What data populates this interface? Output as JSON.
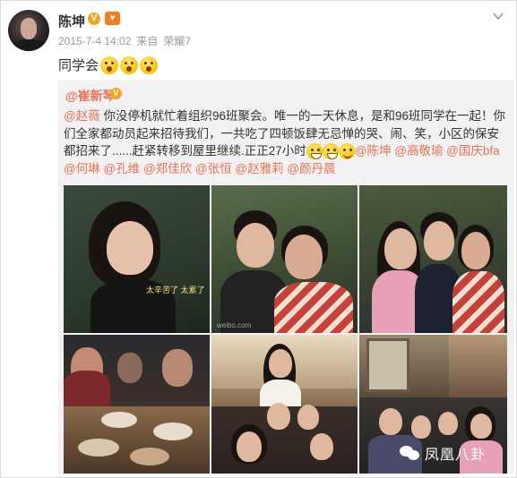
{
  "post": {
    "author": "陈坤",
    "verified_badge": "V",
    "member_badge": "♥",
    "time": "2015-7-4 14:02",
    "source_prefix": "来自",
    "source": "荣耀7",
    "text": "同学会",
    "emojis": [
      "surprised-emoji",
      "surprised-emoji",
      "surprised-emoji"
    ]
  },
  "repost": {
    "author": "@崔新琴",
    "verified_badge": "V",
    "text_parts": [
      {
        "type": "mention",
        "text": "@赵薇"
      },
      {
        "type": "text",
        "text": " 你没停机就忙着组织96班聚会。唯一的一天休息，是和96班同学在一起！你们全家都动员起来招待我们，一共吃了四顿饭肆无忌惮的哭、闹、笑，小区的保安都招来了......赶紧转移到屋里继续.正正27小时"
      },
      {
        "type": "emoji",
        "name": "grin-emoji"
      },
      {
        "type": "emoji",
        "name": "grin-emoji"
      },
      {
        "type": "emoji",
        "name": "smile-emoji"
      },
      {
        "type": "mention",
        "text": "@陈坤"
      },
      {
        "type": "mention",
        "text": " @高敬瑜"
      },
      {
        "type": "mention",
        "text": " @国庆bfa"
      },
      {
        "type": "mention",
        "text": " @何琳"
      },
      {
        "type": "mention",
        "text": " @孔维"
      },
      {
        "type": "mention",
        "text": " @郑佳欣"
      },
      {
        "type": "mention",
        "text": " @张恒"
      },
      {
        "type": "mention",
        "text": " @赵雅莉"
      },
      {
        "type": "mention",
        "text": " @颜丹晨"
      }
    ],
    "photo1_caption": "太辛苦了 太累了",
    "photo2_watermark": "weibo.com"
  },
  "logo": {
    "text": "凤凰八卦",
    "icon": "wechat-icon"
  },
  "colors": {
    "mention": "#eb7350",
    "repost_bg": "#f2f2f5",
    "meta": "#9a9a9a"
  }
}
